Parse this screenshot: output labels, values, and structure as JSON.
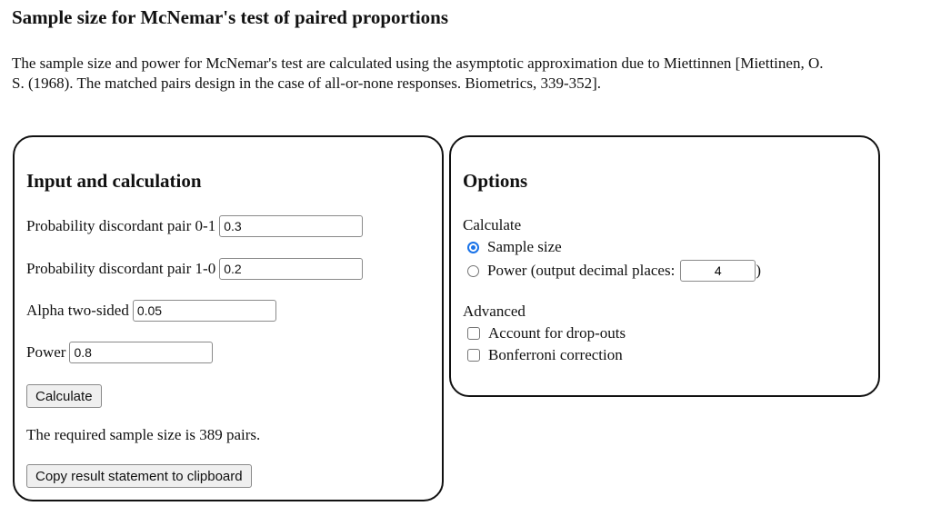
{
  "page": {
    "title": "Sample size for McNemar's test of paired proportions",
    "intro": "The sample size and power for McNemar's test are calculated using the asymptotic approximation due to Miettinnen [Miettinen, O. S. (1968). The matched pairs design in the case of all-or-none responses. Biometrics, 339-352]."
  },
  "input_panel": {
    "heading": "Input and calculation",
    "fields": [
      {
        "label": "Probability discordant pair 0-1",
        "value": "0.3"
      },
      {
        "label": "Probability discordant pair 1-0",
        "value": "0.2"
      },
      {
        "label": "Alpha two-sided",
        "value": "0.05"
      },
      {
        "label": "Power",
        "value": "0.8"
      }
    ],
    "calculate_label": "Calculate",
    "result_text": "The required sample size is 389 pairs.",
    "copy_label": "Copy result statement to clipboard"
  },
  "options_panel": {
    "heading": "Options",
    "calculate_label": "Calculate",
    "radios": [
      {
        "label": "Sample size",
        "checked": true
      },
      {
        "label": "Power (output decimal places:",
        "checked": false
      }
    ],
    "decimal_places": "4",
    "closing_paren": ")",
    "advanced_label": "Advanced",
    "checkboxes": [
      {
        "label": "Account for drop-outs",
        "checked": false
      },
      {
        "label": "Bonferroni correction",
        "checked": false
      }
    ]
  },
  "colors": {
    "radio_accent": "#1a73e8"
  }
}
